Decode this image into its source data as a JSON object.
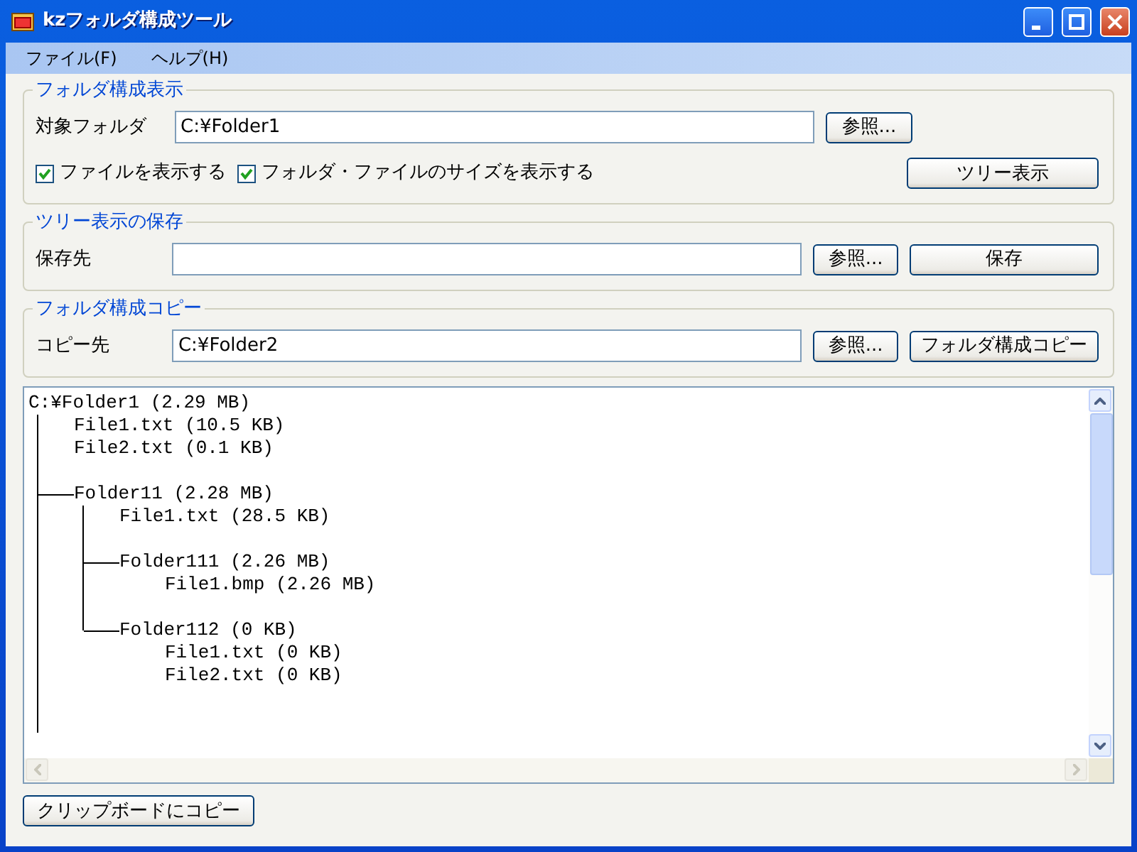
{
  "window": {
    "title": "kzフォルダ構成ツール"
  },
  "menu": [
    {
      "label": "ファイル(F)"
    },
    {
      "label": "ヘルプ(H)"
    }
  ],
  "display_group": {
    "title": "フォルダ構成表示",
    "target_label": "対象フォルダ",
    "target_value": "C:¥Folder1",
    "browse_button": "参照...",
    "options": [
      {
        "label": "ファイルを表示する",
        "checked": true
      },
      {
        "label": "フォルダ・ファイルのサイズを表示する",
        "checked": true
      }
    ],
    "show_button": "ツリー表示"
  },
  "save_group": {
    "title": "ツリー表示の保存",
    "dest_label": "保存先",
    "browse_button": "参照...",
    "save_button": "保存"
  },
  "copy_group": {
    "title": "フォルダ構成コピー",
    "dest_label": "コピー先",
    "dest_value": "C:¥Folder2",
    "browse_button": "参照...",
    "copy_button": "フォルダ構成コピー"
  },
  "tree": {
    "kind": "folder",
    "label": "C:¥Folder1 (2.29 MB)",
    "children": [
      {
        "kind": "file",
        "label": "File1.txt (10.5 KB)"
      },
      {
        "kind": "file",
        "label": "File2.txt (0.1 KB)"
      },
      {
        "kind": "folder",
        "label": "Folder11 (2.28 MB)",
        "children": [
          {
            "kind": "file",
            "label": "File1.txt (28.5 KB)"
          },
          {
            "kind": "folder",
            "label": "Folder111 (2.26 MB)",
            "children": [
              {
                "kind": "file",
                "label": "File1.bmp (2.26 MB)"
              }
            ]
          },
          {
            "kind": "folder",
            "label": "Folder112 (0 KB)",
            "children": [
              {
                "kind": "file",
                "label": "File1.txt (0 KB)"
              },
              {
                "kind": "file",
                "label": "File2.txt (0 KB)"
              }
            ]
          }
        ]
      }
    ]
  },
  "clipboard_button": "クリップボードにコピー"
}
